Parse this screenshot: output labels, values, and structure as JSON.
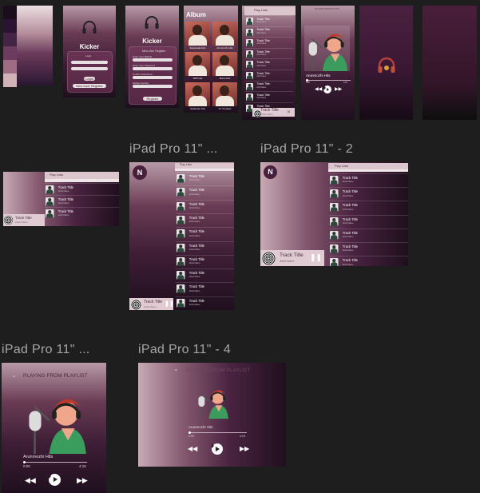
{
  "palette": [
    "#1c0d1c",
    "#2a1431",
    "#432445",
    "#6b3c5f",
    "#9e6d84",
    "#d2b2b9",
    "#f1e3e2"
  ],
  "colors": {
    "canvas": "#1e1e1e",
    "accent": "#4a1f3c",
    "light": "#e0cbd2"
  },
  "login": {
    "app_name": "Kicker",
    "login_label": "Login",
    "login_btn": "Login",
    "register_link": "New User Register",
    "register_title": "New User Register",
    "register_btn": "Register",
    "fields": [
      "Enter Your Mail ID",
      "Enter Your Password",
      "Confirm Password",
      "Mobile Number"
    ]
  },
  "album": {
    "title": "Album",
    "items": [
      "Ilaiyaraaja Hits",
      "Arunmozhi Hits",
      "SPB Hits",
      "Mano Hits",
      "Hariharan Hits",
      "KJ Yesudas"
    ]
  },
  "playlist": {
    "header": "Play Lists",
    "track_title": "Track Title",
    "artist": "Artist Name"
  },
  "mini_player": {
    "title": "Track Title",
    "artist": "Artist Name"
  },
  "small_player": {
    "header": "PLAYING FROM PLAYLIST",
    "song": "Arunmozhi Hits",
    "elapsed": "0:00",
    "duration": "4:15"
  },
  "boards": {
    "ipad1": "iPad Pro 11\" ...",
    "ipad2": "iPad Pro 11\" - 2",
    "ipad3": "iPad Pro 11\" ...",
    "ipad4": "iPad Pro 11\" - 4"
  },
  "badge_letter": "N",
  "player": {
    "header": "PLAYING FROM PLAYLIST",
    "song": "Arunmozhi Hits",
    "elapsed": "0:00",
    "duration": "4:15"
  }
}
